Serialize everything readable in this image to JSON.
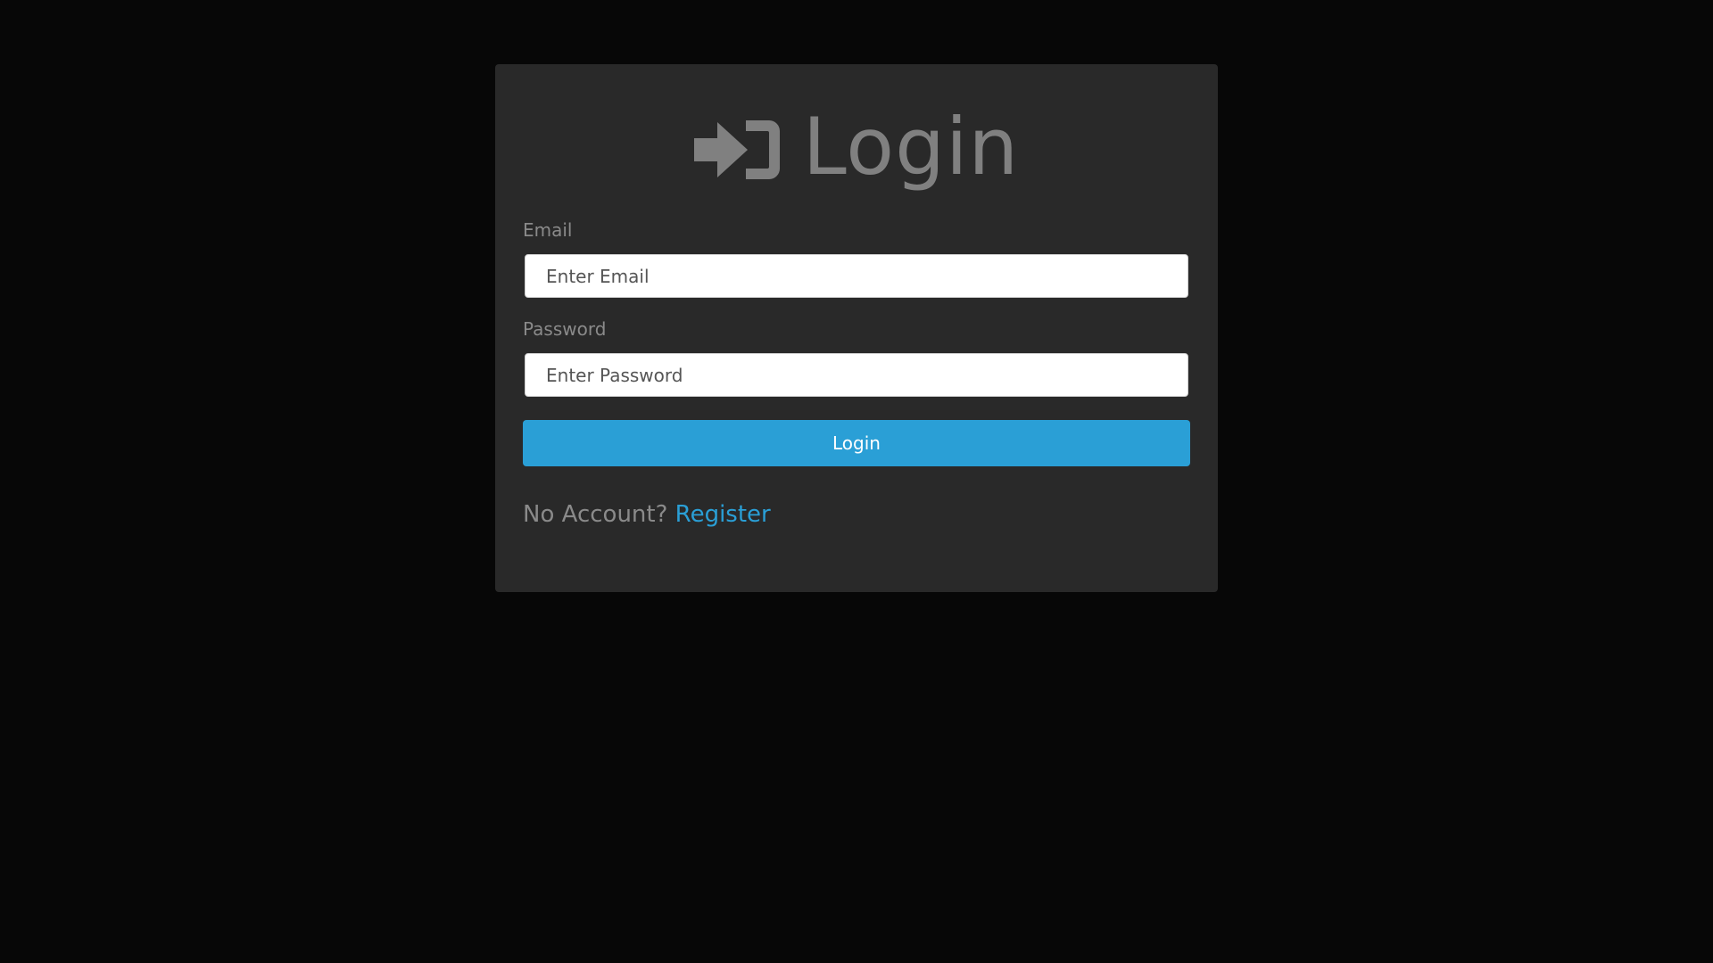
{
  "login_form": {
    "heading": "Login",
    "heading_icon": "sign-in-icon",
    "email": {
      "label": "Email",
      "value": "",
      "placeholder": "Enter Email"
    },
    "password": {
      "label": "Password",
      "value": "",
      "placeholder": "Enter Password"
    },
    "submit_label": "Login",
    "no_account_text": "No Account?",
    "register_link_text": "Register"
  },
  "colors": {
    "page_background": "#070707",
    "card_background": "#292929",
    "heading_text": "#808080",
    "label_text": "#8a8a8a",
    "accent": "#2a9fd6",
    "button_text": "#ffffff",
    "input_background": "#ffffff"
  }
}
